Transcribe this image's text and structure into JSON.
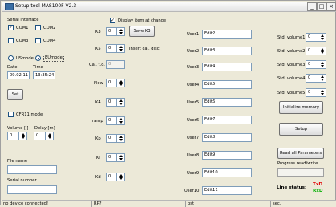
{
  "window": {
    "title": "Setup tool MAS100F   V2.3",
    "buttons": {
      "minimize": "_",
      "maximize": "□",
      "close": "×"
    }
  },
  "left": {
    "serial_interface_label": "Serial interface",
    "com1": "COM1",
    "com2": "COM2",
    "com3": "COM3",
    "com4": "COM4",
    "com1_checked": true,
    "usmode": "USmode",
    "eumode": "EUmode",
    "eumode_selected": true,
    "date_label": "Date",
    "time_label": "Time",
    "date_value": "09.02.11",
    "time_value": "13:35:24",
    "set_button": "Set",
    "cfr11_label": "CFR11 mode",
    "volume_label": "Volume [l]",
    "delay_label": "Delay [m]",
    "volume_value": "0",
    "delay_value": "0",
    "file_name_label": "File name",
    "file_name_value": "",
    "serial_number_label": "Serial number",
    "serial_number_value": ""
  },
  "middle": {
    "display_items_label": "Display item at change",
    "display_items_checked": true,
    "k3_label": "K3",
    "k3_value": "0",
    "save_k3_button": "Save K3",
    "k5_label": "K5",
    "k5_value": "0",
    "insert_cal_label": "Insert cal. disc!",
    "cal_to_label": "Cal. t.o.",
    "cal_to_value": "0",
    "flow_label": "Flow",
    "flow_value": "0",
    "k4_label": "K4",
    "k4_value": "0",
    "ramp_label": "ramp",
    "ramp_value": "0",
    "kp_label": "Kp",
    "kp_value": "0",
    "ki_label": "Ki",
    "ki_value": "0",
    "kd_label": "Kd",
    "kd_value": "0"
  },
  "users": [
    {
      "label": "User1",
      "value": "Edit2"
    },
    {
      "label": "User2",
      "value": "Edit3"
    },
    {
      "label": "User3",
      "value": "Edit4"
    },
    {
      "label": "User4",
      "value": "Edit5"
    },
    {
      "label": "User5",
      "value": "Edit6"
    },
    {
      "label": "User6",
      "value": "Edit7"
    },
    {
      "label": "User7",
      "value": "Edit8"
    },
    {
      "label": "User8",
      "value": "Edit9"
    },
    {
      "label": "User9",
      "value": "Edit10"
    },
    {
      "label": "User10",
      "value": "Edit11"
    }
  ],
  "right": {
    "std_volumes": [
      {
        "label": "Std. volume1",
        "value": "0"
      },
      {
        "label": "Std. volume2",
        "value": "0"
      },
      {
        "label": "Std. volume3",
        "value": "0"
      },
      {
        "label": "Std. volume4",
        "value": "0"
      },
      {
        "label": "Std. volume5",
        "value": "0"
      }
    ],
    "initialize_memory_button": "Initialize memory",
    "setup_button": "Setup",
    "read_all_button": "Read all Parameters",
    "progress_label": "Progress read/write",
    "progress_fraction": 0,
    "line_status_label": "Line status:",
    "txd": "TxD",
    "rxd": "RxD",
    "txd_color": "#e00000",
    "rxd_color": "#00b000"
  },
  "statusbar": {
    "panel1": "no device connected!",
    "panel2": "RP?",
    "panel3": "pst",
    "panel4": "sec."
  }
}
